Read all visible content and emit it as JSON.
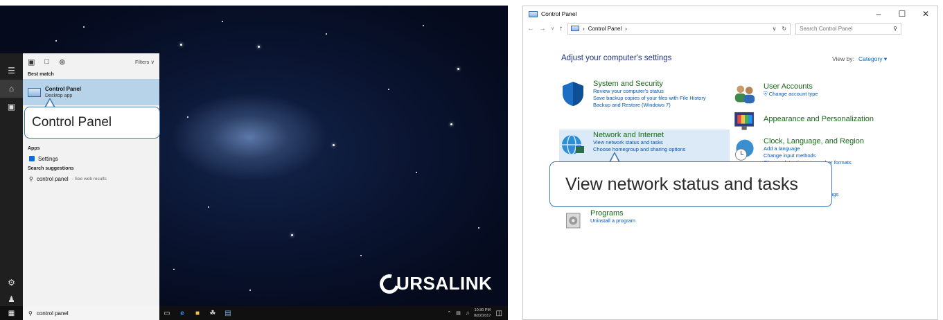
{
  "start_menu": {
    "filters_label": "Filters",
    "best_match_header": "Best match",
    "best_match_title": "Control Panel",
    "best_match_subtitle": "Desktop app",
    "apps_header": "Apps",
    "settings_label": "Settings",
    "suggestions_header": "Search suggestions",
    "suggestion_query": "control panel",
    "suggestion_hint": "- See web results"
  },
  "callouts": {
    "control_panel": "Control Panel",
    "network": "View network status and tasks"
  },
  "taskbar": {
    "search_text": "control panel",
    "clock_time": "10:30 PM",
    "clock_date": "8/22/2017"
  },
  "brand": {
    "text": "URSALINK"
  },
  "control_panel_window": {
    "title": "Control Panel",
    "breadcrumb": "Control Panel",
    "search_placeholder": "Search Control Panel",
    "heading": "Adjust your computer's settings",
    "view_by_label": "View by:",
    "view_by_value": "Category",
    "categories": {
      "system": {
        "title": "System and Security",
        "links": [
          "Review your computer's status",
          "Save backup copies of your files with File History",
          "Backup and Restore (Windows 7)"
        ]
      },
      "network": {
        "title": "Network and Internet",
        "links": [
          "View network status and tasks",
          "Choose homegroup and sharing options"
        ]
      },
      "programs": {
        "title": "Programs",
        "links": [
          "Uninstall a program"
        ]
      },
      "users": {
        "title": "User Accounts",
        "links": [
          "Change account type"
        ]
      },
      "appearance": {
        "title": "Appearance and Personalization"
      },
      "clock": {
        "title": "Clock, Language, and Region",
        "links": [
          "Add a language",
          "Change input methods",
          "Change date, time, or number formats"
        ]
      },
      "ease_fragment": "ngs"
    }
  },
  "colors": {
    "accent": "#3d78b4",
    "highlight": "#b7d3ea",
    "link": "#0055bb",
    "category_title": "#1a6b1a"
  }
}
